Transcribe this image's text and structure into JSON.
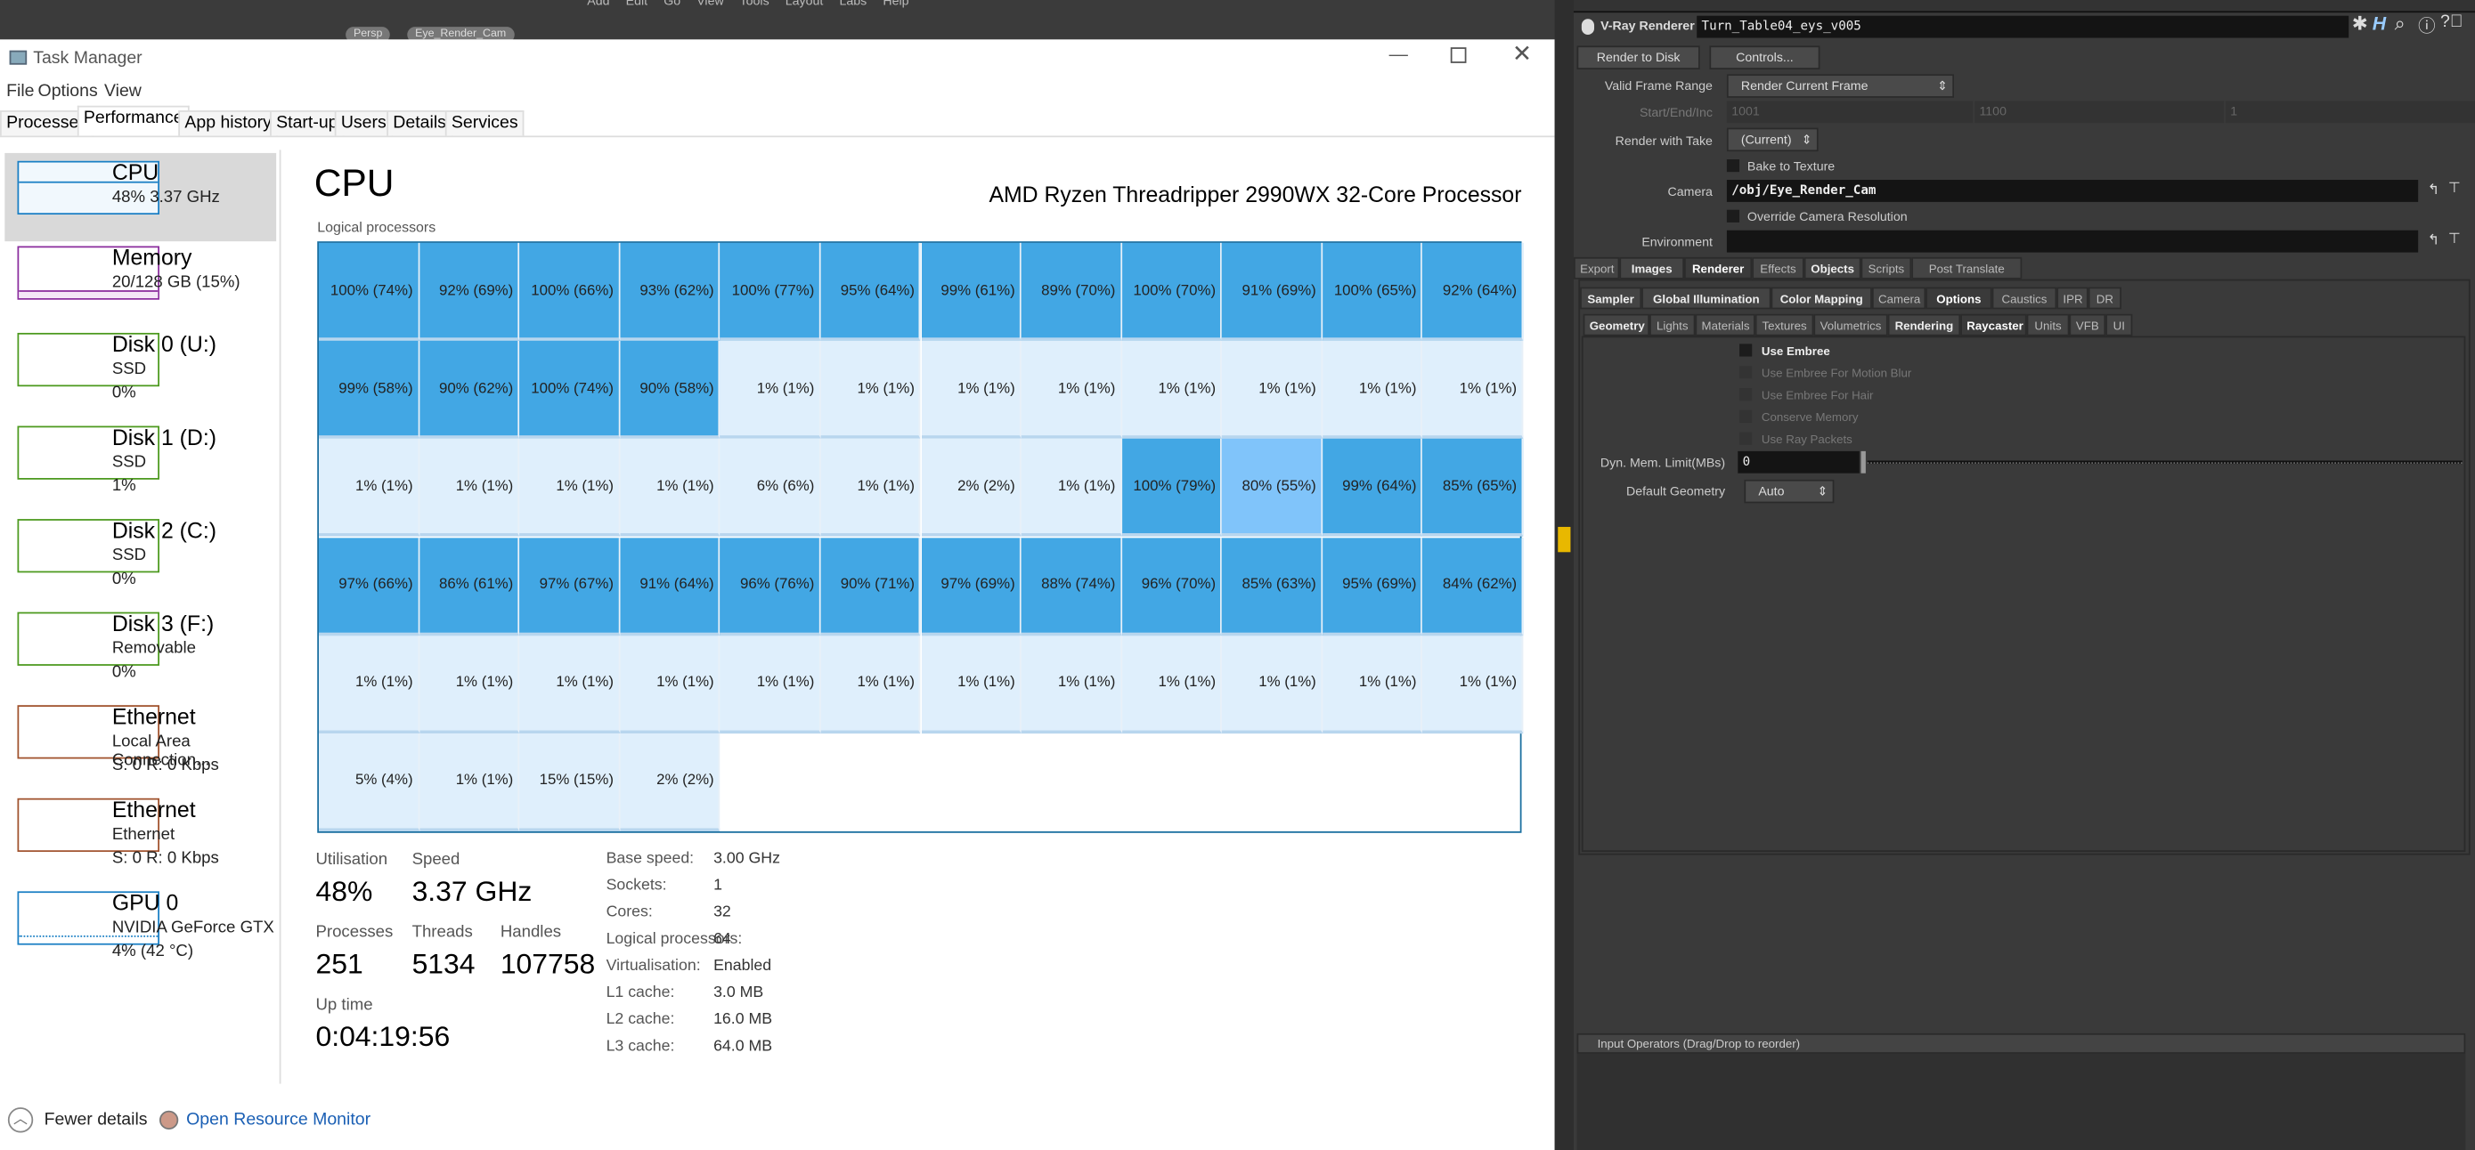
{
  "background": {
    "menu": [
      "Add",
      "Edit",
      "Go",
      "View",
      "Tools",
      "Layout",
      "Labs",
      "Help"
    ],
    "viewport_pills": [
      "Persp",
      "Eye_Render_Cam"
    ]
  },
  "window": {
    "title": "Task Manager",
    "controls": [
      "minimize-icon",
      "maximize-icon",
      "close-icon"
    ]
  },
  "menu": [
    "File",
    "Options",
    "View"
  ],
  "tabs": [
    {
      "label": "Processes"
    },
    {
      "label": "Performance",
      "active": true
    },
    {
      "label": "App history"
    },
    {
      "label": "Start-up"
    },
    {
      "label": "Users"
    },
    {
      "label": "Details"
    },
    {
      "label": "Services"
    }
  ],
  "sidebar": [
    {
      "title": "CPU",
      "line2": "48%  3.37 GHz",
      "line3": "",
      "color": "#1a7fc4",
      "selected": true
    },
    {
      "title": "Memory",
      "line2": "20/128 GB (15%)",
      "line3": "",
      "color": "#8b2e9e"
    },
    {
      "title": "Disk 0 (U:)",
      "line2": "SSD",
      "line3": "0%",
      "color": "#4d9a1f"
    },
    {
      "title": "Disk 1 (D:)",
      "line2": "SSD",
      "line3": "1%",
      "color": "#4d9a1f"
    },
    {
      "title": "Disk 2 (C:)",
      "line2": "SSD",
      "line3": "0%",
      "color": "#4d9a1f"
    },
    {
      "title": "Disk 3 (F:)",
      "line2": "Removable",
      "line3": "0%",
      "color": "#4d9a1f"
    },
    {
      "title": "Ethernet",
      "line2": "Local Area Connection...",
      "line3": "S: 0  R: 0 Kbps",
      "color": "#a0522d"
    },
    {
      "title": "Ethernet",
      "line2": "Ethernet",
      "line3": "S: 0  R: 0 Kbps",
      "color": "#a0522d"
    },
    {
      "title": "GPU 0",
      "line2": "NVIDIA GeForce GTX ...",
      "line3": "4%  (42 °C)",
      "color": "#1a7fc4"
    }
  ],
  "footer": {
    "fewer_details": "Fewer details",
    "resource_monitor": "Open Resource Monitor"
  },
  "cpu": {
    "title": "CPU",
    "processor": "AMD Ryzen Threadripper 2990WX 32-Core Processor",
    "grid_label": "Logical processors",
    "colors": {
      "high": "#42a7e4",
      "mid": "#80c4fa",
      "low": "#dfeffc"
    },
    "cells": [
      "100% (74%)",
      "92% (69%)",
      "100% (66%)",
      "93% (62%)",
      "100% (77%)",
      "95% (64%)",
      "99% (61%)",
      "89% (70%)",
      "100% (70%)",
      "91% (69%)",
      "100% (65%)",
      "92% (64%)",
      "99% (58%)",
      "90% (62%)",
      "100% (74%)",
      "90% (58%)",
      "1% (1%)",
      "1% (1%)",
      "1% (1%)",
      "1% (1%)",
      "1% (1%)",
      "1% (1%)",
      "1% (1%)",
      "1% (1%)",
      "1% (1%)",
      "1% (1%)",
      "1% (1%)",
      "1% (1%)",
      "6% (6%)",
      "1% (1%)",
      "2% (2%)",
      "1% (1%)",
      "100% (79%)",
      "80% (55%)",
      "99% (64%)",
      "85% (65%)",
      "97% (66%)",
      "86% (61%)",
      "97% (67%)",
      "91% (64%)",
      "96% (76%)",
      "90% (71%)",
      "97% (69%)",
      "88% (74%)",
      "96% (70%)",
      "85% (63%)",
      "95% (69%)",
      "84% (62%)",
      "1% (1%)",
      "1% (1%)",
      "1% (1%)",
      "1% (1%)",
      "1% (1%)",
      "1% (1%)",
      "1% (1%)",
      "1% (1%)",
      "1% (1%)",
      "1% (1%)",
      "1% (1%)",
      "1% (1%)",
      "5% (4%)",
      "1% (1%)",
      "15% (15%)",
      "2% (2%)"
    ],
    "stats": {
      "utilisation_label": "Utilisation",
      "utilisation": "48%",
      "speed_label": "Speed",
      "speed": "3.37 GHz",
      "processes_label": "Processes",
      "processes": "251",
      "threads_label": "Threads",
      "threads": "5134",
      "handles_label": "Handles",
      "handles": "107758",
      "uptime_label": "Up time",
      "uptime": "0:04:19:56"
    },
    "specs": [
      [
        "Base speed:",
        "3.00 GHz"
      ],
      [
        "Sockets:",
        "1"
      ],
      [
        "Cores:",
        "32"
      ],
      [
        "Logical processors:",
        "64"
      ],
      [
        "Virtualisation:",
        "Enabled"
      ],
      [
        "L1 cache:",
        "3.0 MB"
      ],
      [
        "L2 cache:",
        "16.0 MB"
      ],
      [
        "L3 cache:",
        "64.0 MB"
      ]
    ]
  },
  "vray": {
    "node_type": "V-Ray Renderer",
    "node_name": "Turn_Table04_eys_v005",
    "render_to_disk": "Render to Disk",
    "controls": "Controls...",
    "valid_frame_range_label": "Valid Frame Range",
    "valid_frame_range": "Render Current Frame",
    "start_end_inc_label": "Start/End/Inc",
    "start": "1001",
    "end": "1100",
    "inc": "1",
    "take_label": "Render with Take",
    "take": "(Current)",
    "bake_to_texture": "Bake to Texture",
    "camera_label": "Camera",
    "camera": "/obj/Eye_Render_Cam",
    "override_res": "Override Camera Resolution",
    "environment_label": "Environment",
    "environment": "",
    "tabs1": [
      "Export",
      "Images",
      "Renderer",
      "Effects",
      "Objects",
      "Scripts",
      "Post Translate"
    ],
    "tabs2": [
      "Sampler",
      "Global Illumination",
      "Color Mapping",
      "Camera",
      "Options",
      "Caustics",
      "IPR",
      "DR"
    ],
    "tabs3": [
      "Geometry",
      "Lights",
      "Materials",
      "Textures",
      "Volumetrics",
      "Rendering",
      "Raycaster",
      "Units",
      "VFB",
      "UI"
    ],
    "checks": [
      {
        "label": "Use Embree",
        "enabled": true
      },
      {
        "label": "Use Embree For Motion Blur",
        "enabled": false
      },
      {
        "label": "Use Embree For Hair",
        "enabled": false
      },
      {
        "label": "Conserve Memory",
        "enabled": false
      },
      {
        "label": "Use Ray Packets",
        "enabled": false
      }
    ],
    "dyn_mem_label": "Dyn. Mem. Limit(MBs)",
    "dyn_mem": "0",
    "default_geometry_label": "Default Geometry",
    "default_geometry": "Auto",
    "input_operators": "Input Operators (Drag/Drop to reorder)"
  }
}
